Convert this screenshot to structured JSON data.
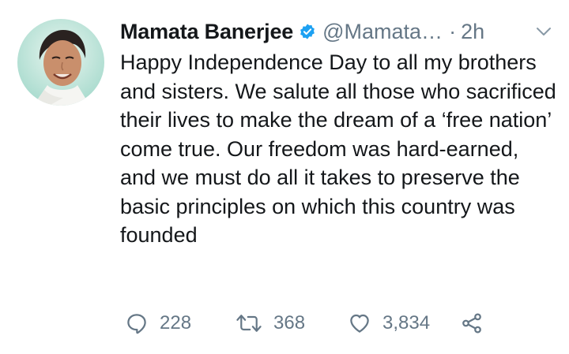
{
  "tweet": {
    "author": {
      "display_name": "Mamata Banerjee",
      "handle": "@Mamata…",
      "verified": true,
      "avatar_icon": "avatar-photo"
    },
    "separator": "·",
    "timestamp": "2h",
    "text": "Happy Independence Day to all my brothers and sisters. We salute all those who sacrificed their lives to make the dream of a ‘free nation’ come true. Our freedom was hard-earned, and we must do all it takes to preserve the basic principles on which this country was founded",
    "actions": {
      "reply": {
        "icon": "reply-icon",
        "count": "228"
      },
      "retweet": {
        "icon": "retweet-icon",
        "count": "368"
      },
      "like": {
        "icon": "heart-icon",
        "count": "3,834"
      },
      "share": {
        "icon": "share-icon"
      }
    }
  },
  "colors": {
    "text_primary": "#14171a",
    "text_secondary": "#657786",
    "verified_blue": "#1da1f2",
    "background": "#ffffff"
  }
}
